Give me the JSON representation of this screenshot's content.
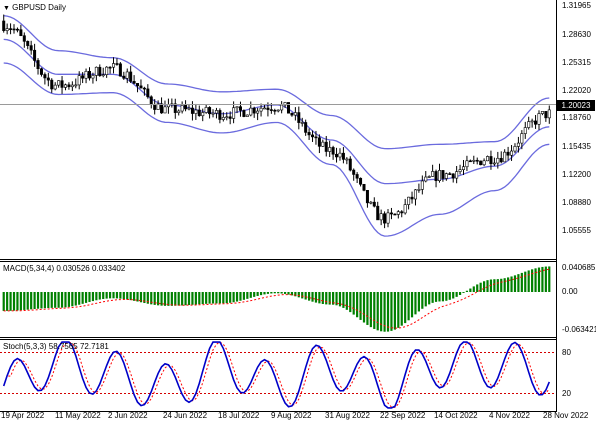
{
  "main_label": "GBPUSD Daily",
  "price_axis": [
    "1.31965",
    "1.28630",
    "1.25315",
    "1.22020",
    "1.18760",
    "1.15435",
    "1.12200",
    "1.08880",
    "1.05555"
  ],
  "current_price": "1.20023",
  "macd_label": "MACD(5,34,4) 0.030526 0.033402",
  "macd_axis": [
    "0.040685",
    "0.00",
    "-0.063421"
  ],
  "stoch_label": "Stoch(5,3,3) 58.7565 72.7181",
  "stoch_axis": [
    "80",
    "20"
  ],
  "dates": [
    "19 Apr 2022",
    "11 May 2022",
    "2 Jun 2022",
    "24 Jun 2022",
    "18 Jul 2022",
    "9 Aug 2022",
    "31 Aug 2022",
    "22 Sep 2022",
    "14 Oct 2022",
    "4 Nov 2022",
    "28 Nov 2022"
  ],
  "colors": {
    "bollinger": "#6b6bde",
    "macd_hist": "#008000",
    "macd_signal": "#ff0000",
    "stoch_main": "#0000c8",
    "stoch_signal": "#ff0000",
    "candle_up": "#ffffff",
    "candle_down": "#000000"
  },
  "chart_data": [
    {
      "type": "candlestick",
      "title": "GBPUSD Daily",
      "y_axis_ticks": [
        1.31965,
        1.2863,
        1.25315,
        1.2202,
        1.1876,
        1.15435,
        1.122,
        1.0888,
        1.05555
      ],
      "ylim": [
        1.035,
        1.33
      ],
      "current_price": 1.20023,
      "indicators": [
        "Bollinger Bands"
      ],
      "x": [
        "19 Apr 2022",
        "11 May 2022",
        "2 Jun 2022",
        "24 Jun 2022",
        "18 Jul 2022",
        "9 Aug 2022",
        "31 Aug 2022",
        "22 Sep 2022",
        "14 Oct 2022",
        "4 Nov 2022",
        "28 Nov 2022"
      ],
      "close": [
        1.302,
        1.232,
        1.252,
        1.205,
        1.2,
        1.209,
        1.158,
        1.08,
        1.13,
        1.15,
        1.2
      ],
      "bb_upper": [
        1.312,
        1.272,
        1.264,
        1.234,
        1.225,
        1.228,
        1.198,
        1.16,
        1.165,
        1.168,
        1.218
      ],
      "bb_middle": [
        1.285,
        1.245,
        1.245,
        1.21,
        1.2,
        1.21,
        1.17,
        1.12,
        1.125,
        1.14,
        1.185
      ],
      "bb_lower": [
        1.258,
        1.222,
        1.224,
        1.19,
        1.178,
        1.19,
        1.142,
        1.06,
        1.085,
        1.112,
        1.165
      ]
    },
    {
      "type": "bar",
      "title": "MACD(5,34,4)",
      "values_shown": {
        "main": 0.030526,
        "signal": 0.033402
      },
      "y_axis_ticks": [
        0.040685,
        0.0,
        -0.063421
      ],
      "categories": [
        "19 Apr 2022",
        "11 May 2022",
        "2 Jun 2022",
        "24 Jun 2022",
        "18 Jul 2022",
        "9 Aug 2022",
        "31 Aug 2022",
        "22 Sep 2022",
        "14 Oct 2022",
        "4 Nov 2022",
        "28 Nov 2022"
      ],
      "values": [
        -0.03,
        -0.025,
        -0.01,
        -0.022,
        -0.018,
        -0.002,
        -0.02,
        -0.063,
        -0.015,
        0.02,
        0.04
      ]
    },
    {
      "type": "line",
      "title": "Stoch(5,3,3)",
      "values_shown": {
        "main": 58.7565,
        "signal": 72.7181
      },
      "levels": [
        80,
        20
      ],
      "ylim": [
        0,
        100
      ],
      "x": [
        "19 Apr 2022",
        "11 May 2022",
        "2 Jun 2022",
        "24 Jun 2022",
        "18 Jul 2022",
        "9 Aug 2022",
        "31 Aug 2022",
        "22 Sep 2022",
        "14 Oct 2022",
        "4 Nov 2022",
        "28 Nov 2022"
      ],
      "series": [
        {
          "values": [
            15,
            95,
            50,
            10,
            90,
            15,
            80,
            10,
            85,
            85,
            60
          ]
        },
        {
          "values": [
            25,
            90,
            60,
            18,
            85,
            22,
            75,
            18,
            80,
            82,
            72
          ]
        }
      ]
    }
  ]
}
